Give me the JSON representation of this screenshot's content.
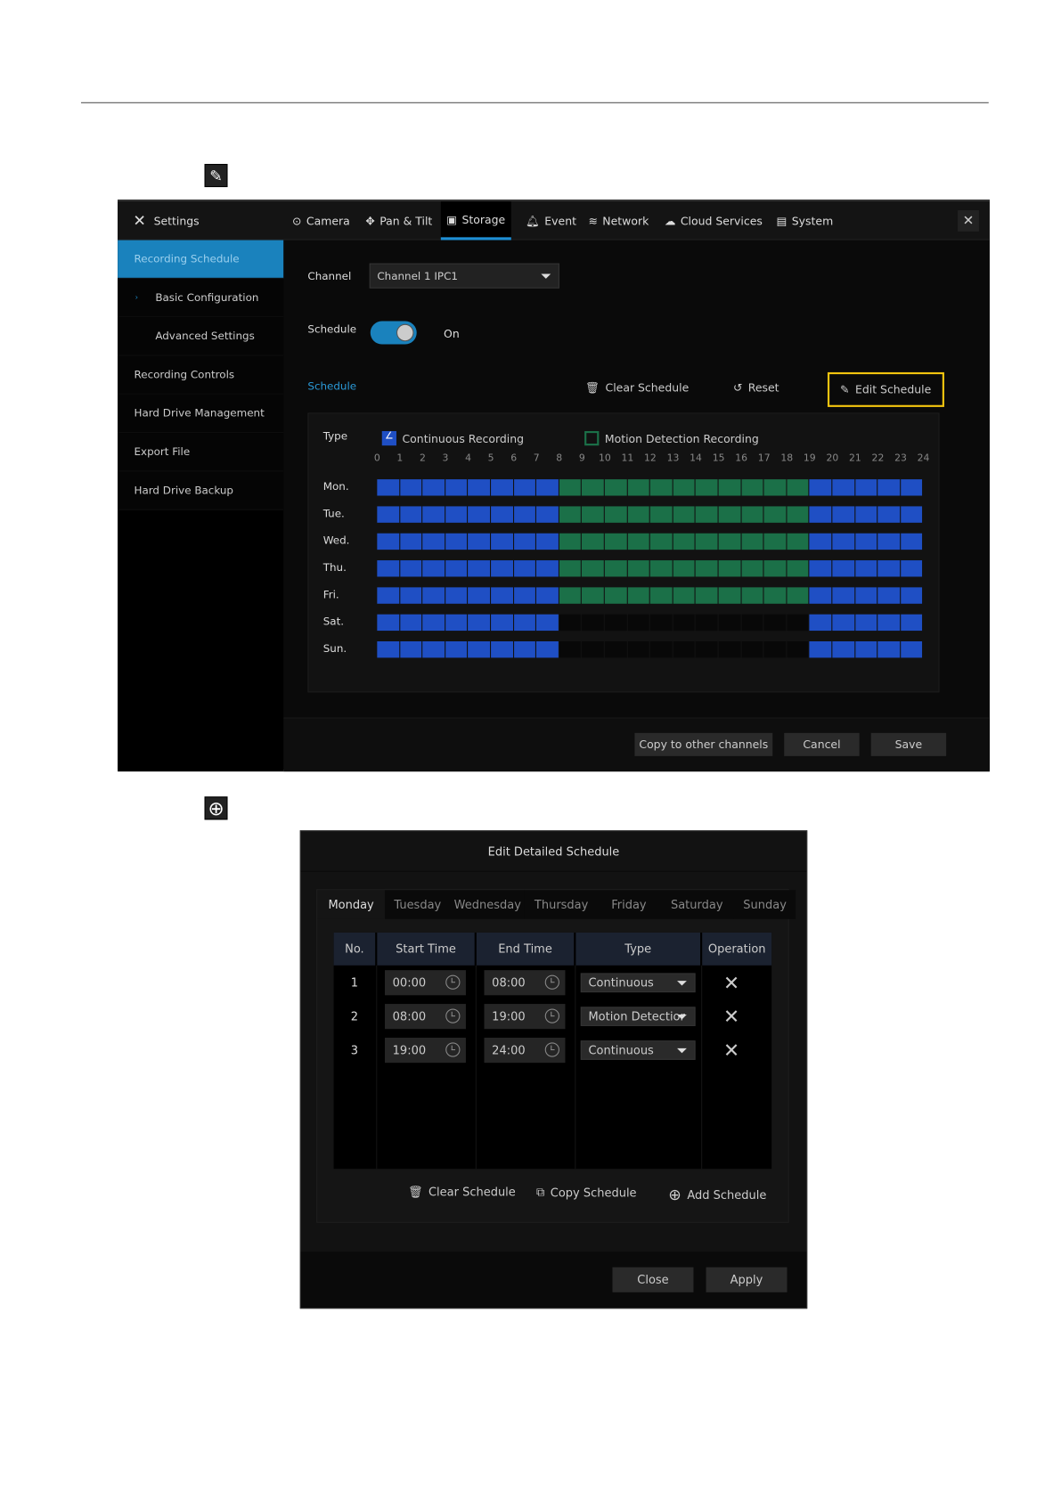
{
  "top_icons": {
    "edit": "edit-icon",
    "add": "add-circle-icon"
  },
  "settings": {
    "title": "Settings",
    "tabs": [
      {
        "label": "Camera",
        "icon": "camera-icon"
      },
      {
        "label": "Pan & Tilt",
        "icon": "pan-tilt-icon"
      },
      {
        "label": "Storage",
        "icon": "storage-icon"
      },
      {
        "label": "Event",
        "icon": "bell-icon"
      },
      {
        "label": "Network",
        "icon": "wifi-icon"
      },
      {
        "label": "Cloud Services",
        "icon": "cloud-icon"
      },
      {
        "label": "System",
        "icon": "system-icon"
      }
    ],
    "active_tab": "Storage",
    "sidebar": [
      "Recording Schedule",
      "Basic Configuration",
      "Advanced Settings",
      "Recording Controls",
      "Hard Drive Management",
      "Export File",
      "Hard Drive Backup"
    ],
    "channel_label": "Channel",
    "channel_value": "Channel 1 IPC1",
    "schedule_label": "Schedule",
    "schedule_state": "On",
    "schedule_section": "Schedule",
    "actions": {
      "clear": "Clear Schedule",
      "reset": "Reset",
      "edit": "Edit Schedule"
    },
    "type_label": "Type",
    "legend": {
      "continuous": "Continuous Recording",
      "motion": "Motion Detection Recording"
    },
    "hours": [
      "0",
      "1",
      "2",
      "3",
      "4",
      "5",
      "6",
      "7",
      "8",
      "9",
      "10",
      "11",
      "12",
      "13",
      "14",
      "15",
      "16",
      "17",
      "18",
      "19",
      "20",
      "21",
      "22",
      "23",
      "24"
    ],
    "days": [
      {
        "label": "Mon.",
        "slots": "CCCCCCCCMMMMMMMMMMMCCCCC"
      },
      {
        "label": "Tue.",
        "slots": "CCCCCCCCMMMMMMMMMMMCCCCC"
      },
      {
        "label": "Wed.",
        "slots": "CCCCCCCCMMMMMMMMMMMCCCCC"
      },
      {
        "label": "Thu.",
        "slots": "CCCCCCCCMMMMMMMMMMMCCCCC"
      },
      {
        "label": "Fri.",
        "slots": "CCCCCCCCMMMMMMMMMMMCCCCC"
      },
      {
        "label": "Sat.",
        "slots": "CCCCCCCCNNNNNNNNNNNCCCCC"
      },
      {
        "label": "Sun.",
        "slots": "CCCCCCCCNNNNNNNNNNNCCCCC"
      }
    ],
    "colors": {
      "continuous": "#1f4fc4",
      "motion": "#1b7048",
      "highlight": "#f2c40f",
      "accent": "#1a82bd"
    },
    "footer": {
      "copy": "Copy to other channels",
      "cancel": "Cancel",
      "save": "Save"
    }
  },
  "dialog": {
    "title": "Edit Detailed Schedule",
    "days": [
      "Monday",
      "Tuesday",
      "Wednesday",
      "Thursday",
      "Friday",
      "Saturday",
      "Sunday"
    ],
    "columns": [
      "No.",
      "Start Time",
      "End Time",
      "Type",
      "Operation"
    ],
    "rows": [
      {
        "no": "1",
        "start": "00:00",
        "end": "08:00",
        "type": "Continuous"
      },
      {
        "no": "2",
        "start": "08:00",
        "end": "19:00",
        "type": "Motion Detectior"
      },
      {
        "no": "3",
        "start": "19:00",
        "end": "24:00",
        "type": "Continuous"
      }
    ],
    "actions": {
      "clear": "Clear Schedule",
      "copy": "Copy Schedule",
      "add": "Add Schedule"
    },
    "close": "Close",
    "apply": "Apply"
  }
}
